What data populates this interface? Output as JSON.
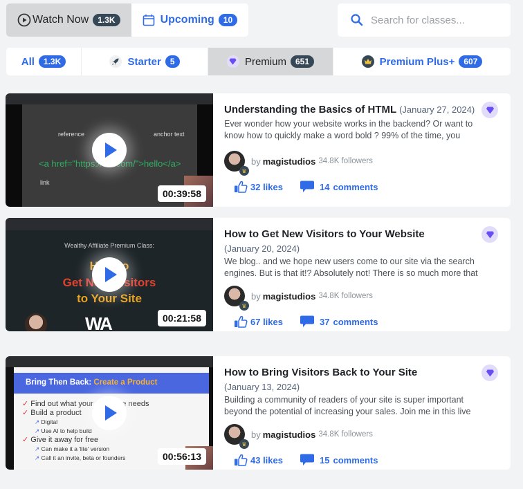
{
  "top_tabs": [
    {
      "label": "Watch Now",
      "count": "1.3K",
      "icon": "play-circle-icon",
      "active": true
    },
    {
      "label": "Upcoming",
      "count": "10",
      "icon": "calendar-icon",
      "active": false
    }
  ],
  "search": {
    "placeholder": "Search for classes...",
    "value": "",
    "icon": "search-icon"
  },
  "filter_tabs": [
    {
      "label": "All",
      "count": "1.3K",
      "icon": "",
      "active": false
    },
    {
      "label": "Starter",
      "count": "5",
      "icon": "rocket-icon",
      "active": false
    },
    {
      "label": "Premium",
      "count": "651",
      "icon": "gem-icon",
      "active": true
    },
    {
      "label": "Premium Plus+",
      "count": "607",
      "icon": "crown-icon",
      "active": false
    }
  ],
  "classes": [
    {
      "title": "Understanding the Basics of HTML",
      "date": "(January 27, 2024)",
      "description": "Ever wonder how your website works in the backend? Or want to know how to quickly make a word bold ? 99% of the time, you",
      "duration": "00:39:58",
      "author_prefix": "by",
      "author": "magistudios",
      "followers": "34.8K followers",
      "likes": "32 likes",
      "comments": "14",
      "comments_label": "comments",
      "tier_icon": "gem-icon",
      "thumb_text": {
        "label_left": "reference",
        "label_right": "anchor text",
        "code": "<a href=\"https://w...com/\">hello</a>",
        "bottom_left": "link"
      }
    },
    {
      "title": "How to Get New Visitors to Your Website",
      "date": "(January 20, 2024)",
      "description": "We blog.. and we hope new users come to our site via the search engines. But is that it!? Absolutely not! There is so much more that can",
      "duration": "00:21:58",
      "author_prefix": "by",
      "author": "magistudios",
      "followers": "34.8K followers",
      "likes": "67 likes",
      "comments": "37",
      "comments_label": "comments",
      "tier_icon": "gem-icon",
      "thumb_text": {
        "subtitle": "Wealthy Affiliate Premium Class:",
        "line1": "How to",
        "line2": "Get New Visitors",
        "line3": "to Your Site",
        "logo": "WA"
      }
    },
    {
      "title": "How to Bring Visitors Back to Your Site",
      "date": "(January 13, 2024)",
      "description": "Building a community of readers of your site is super important beyond the potential of increasing your sales. Join me in this live class",
      "duration": "00:56:13",
      "author_prefix": "by",
      "author": "magistudios",
      "followers": "34.8K followers",
      "likes": "43 likes",
      "comments": "15",
      "comments_label": "comments",
      "tier_icon": "gem-icon",
      "thumb_text": {
        "header_a": "Bring Then Back: ",
        "header_b": "Create a Product",
        "bullets": [
          "Find out what your audience needs",
          "Build a product",
          "Digital",
          "Use AI to help build",
          "Give it away for free",
          "Can make it a 'lite' version",
          "Call it an invite, beta or founders"
        ]
      }
    }
  ],
  "colors": {
    "accent": "#2f6be6",
    "badge_dark": "#364756",
    "gem": "#6a4cf5",
    "gem_bg": "#e2dcfb",
    "crown": "#f1c23c"
  }
}
